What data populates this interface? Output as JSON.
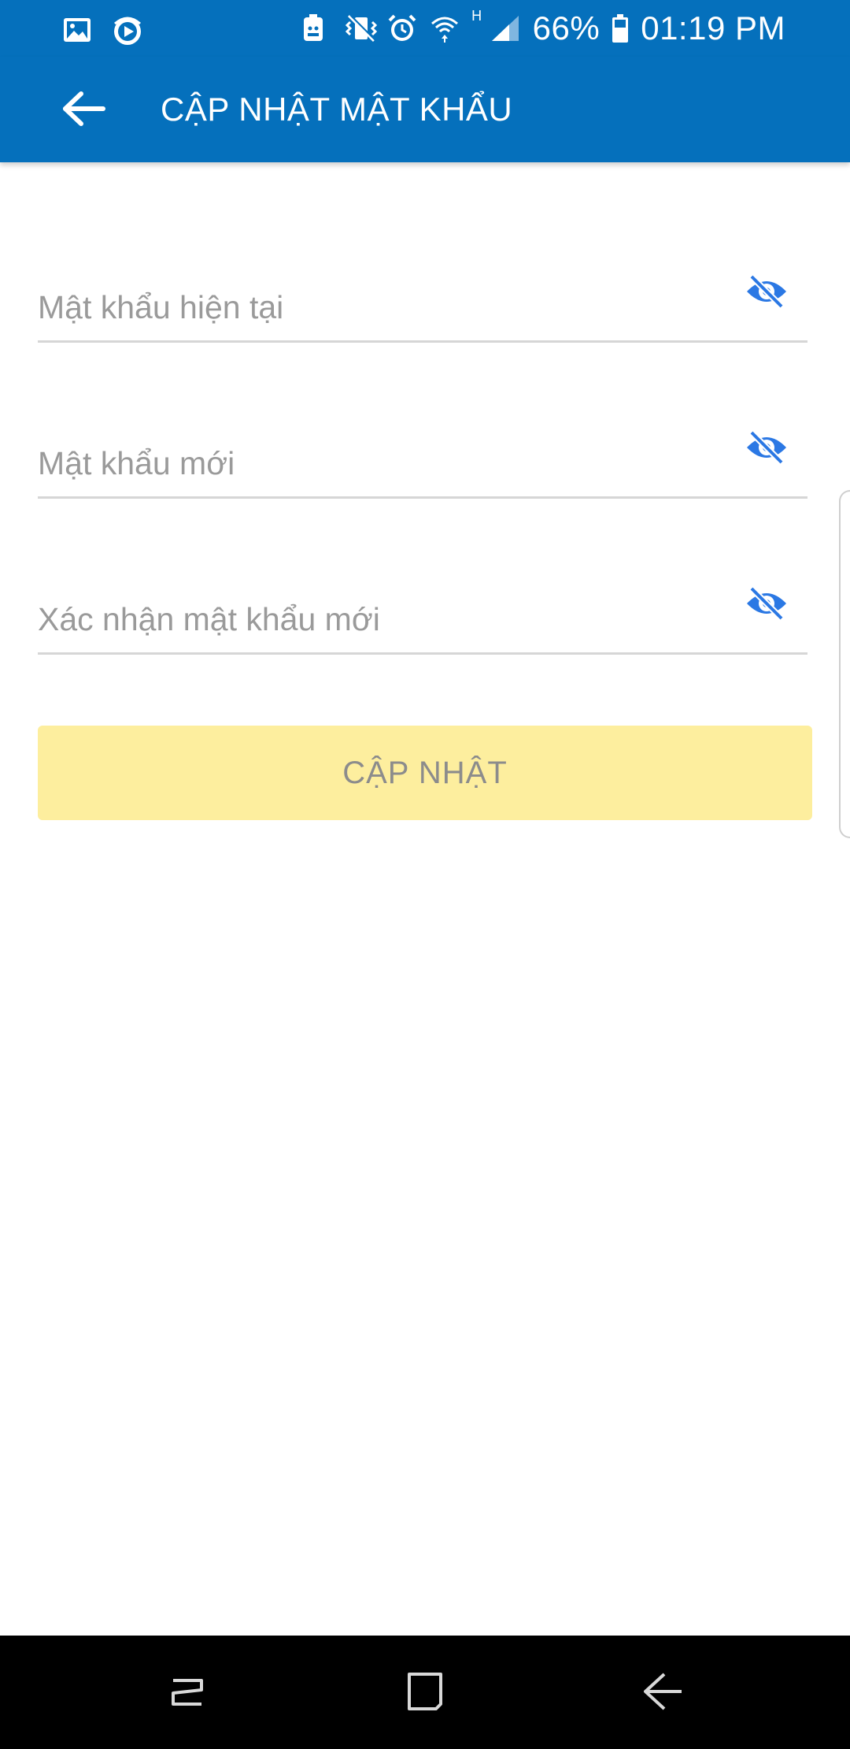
{
  "status_bar": {
    "battery": "66%",
    "time": "01:19 PM",
    "network_type": "H",
    "left_icons": [
      "gallery-icon",
      "media-player-icon"
    ],
    "right_icons": [
      "android-notification-icon",
      "vibrate-mode-icon",
      "alarm-icon",
      "wifi-icon",
      "network-h-indicator",
      "signal-icon",
      "battery-icon"
    ]
  },
  "app_bar": {
    "title": "CẬP NHẬT MẬT KHẨU",
    "back_icon": "arrow-left-icon",
    "background": "#0570bc"
  },
  "form": {
    "fields": [
      {
        "placeholder": "Mật khẩu hiện tại",
        "value": "",
        "toggle_icon": "eye-off-icon"
      },
      {
        "placeholder": "Mật khẩu mới",
        "value": "",
        "toggle_icon": "eye-off-icon"
      },
      {
        "placeholder": "Xác nhận mật khẩu mới",
        "value": "",
        "toggle_icon": "eye-off-icon"
      }
    ],
    "submit_label": "CẬP NHẬT",
    "submit_background": "#fdee9e",
    "eye_icon_color": "#2b78e4"
  },
  "nav_bar": {
    "buttons": [
      "recent-apps-icon",
      "home-icon",
      "back-icon"
    ]
  }
}
